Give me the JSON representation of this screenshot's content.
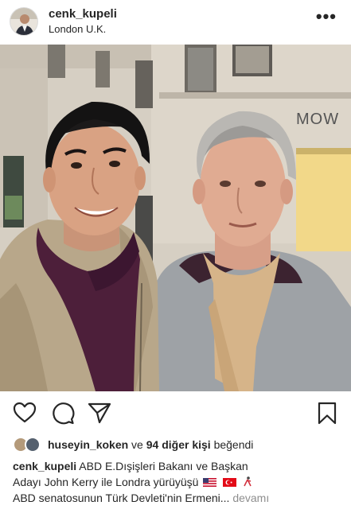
{
  "post": {
    "username": "cenk_kupeli",
    "location": "London U.K.",
    "more_label": "•••"
  },
  "actions": {
    "like_icon": "heart-icon",
    "comment_icon": "comment-icon",
    "share_icon": "share-icon",
    "save_icon": "bookmark-icon"
  },
  "likes": {
    "first_liker": "huseyin_koken",
    "connector": "ve",
    "others_count": "94 diğer kişi",
    "suffix": "beğendi"
  },
  "caption": {
    "username": "cenk_kupeli",
    "line1": "ABD E.Dışişleri Bakanı ve Başkan",
    "line2": "Adayı John Kerry ile Londra yürüyüşü",
    "line3": "ABD senatosunun Türk Devleti'nin Ermeni...",
    "more": "devamı",
    "emojis": [
      "us-flag-icon",
      "turkey-flag-icon",
      "person-icon"
    ]
  },
  "colors": {
    "text": "#262626",
    "muted": "#8e8e8e",
    "border": "#dbdbdb"
  }
}
